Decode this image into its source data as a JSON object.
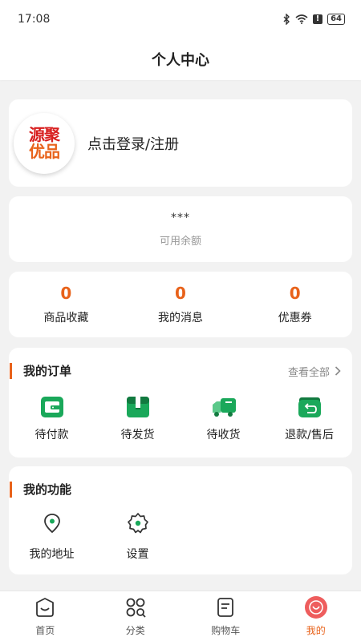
{
  "status_bar": {
    "time": "17:08",
    "battery": "64"
  },
  "header": {
    "title": "个人中心"
  },
  "profile": {
    "logo_line1": "源聚",
    "logo_line2": "优品",
    "login_prompt": "点击登录/注册"
  },
  "balance": {
    "value": "***",
    "label": "可用余额"
  },
  "stats": [
    {
      "value": "0",
      "label": "商品收藏"
    },
    {
      "value": "0",
      "label": "我的消息"
    },
    {
      "value": "0",
      "label": "优惠券"
    }
  ],
  "orders": {
    "title": "我的订单",
    "view_all": "查看全部",
    "items": [
      {
        "label": "待付款",
        "icon": "wallet-icon"
      },
      {
        "label": "待发货",
        "icon": "box-icon"
      },
      {
        "label": "待收货",
        "icon": "truck-icon"
      },
      {
        "label": "退款/售后",
        "icon": "refund-icon"
      }
    ]
  },
  "functions": {
    "title": "我的功能",
    "items": [
      {
        "label": "我的地址",
        "icon": "location-pin-icon"
      },
      {
        "label": "设置",
        "icon": "gear-icon"
      }
    ]
  },
  "tabbar": {
    "items": [
      {
        "label": "首页",
        "icon": "home-bag-icon"
      },
      {
        "label": "分类",
        "icon": "category-grid-icon"
      },
      {
        "label": "购物车",
        "icon": "cart-list-icon"
      },
      {
        "label": "我的",
        "icon": "smile-face-icon"
      }
    ],
    "active": "我的"
  },
  "colors": {
    "accent": "#e8621a",
    "icon_green": "#1aa85a",
    "tab_active_bg": "#ee5d5d"
  }
}
